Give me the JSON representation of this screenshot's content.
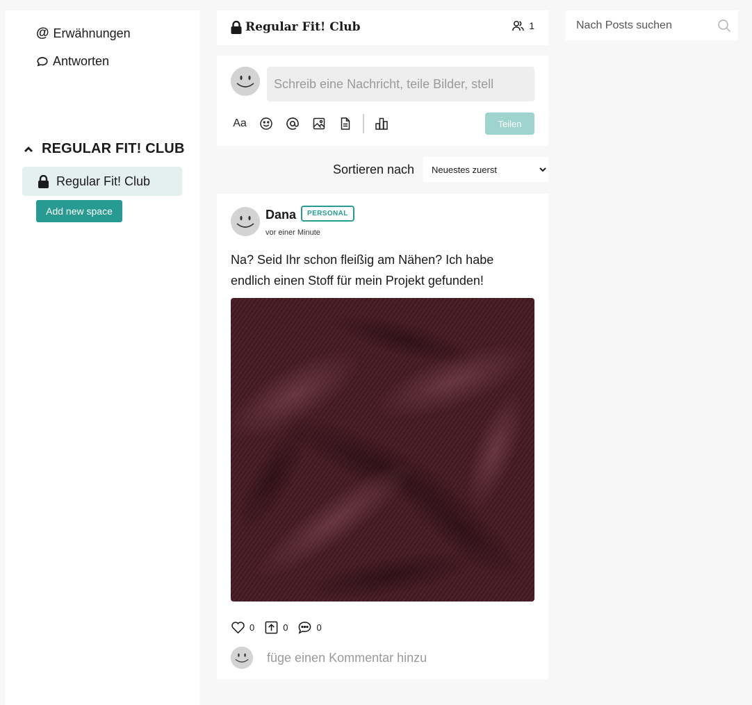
{
  "sidebar": {
    "nav": [
      {
        "label": "Erwähnungen",
        "icon": "at-icon"
      },
      {
        "label": "Antworten",
        "icon": "speech-bubble-icon"
      }
    ],
    "section_title": "REGULAR FIT! CLUB",
    "spaces": [
      {
        "label": "Regular Fit! Club",
        "icon": "lock-icon"
      }
    ],
    "add_space_label": "Add new space"
  },
  "header": {
    "title": "Regular Fit! Club",
    "members_count": "1"
  },
  "composer": {
    "placeholder": "Schreib eine Nachricht, teile Bilder, stell",
    "tools": [
      "text-format-icon",
      "emoji-icon",
      "at-icon",
      "image-icon",
      "document-icon",
      "poll-icon"
    ],
    "tool_text": "Aa",
    "share_label": "Teilen"
  },
  "sort": {
    "label": "Sortieren nach",
    "selected": "Neuestes zuerst"
  },
  "post": {
    "author": "Dana",
    "badge": "PERSONAL",
    "time": "vor einer Minute",
    "text": "Na? Seid Ihr schon fleißig am Nähen? Ich habe endlich einen Stoff für mein Projekt gefunden!",
    "likes": "0",
    "shares": "0",
    "comments": "0",
    "comment_placeholder": "füge einen Kommentar hinzu"
  },
  "search": {
    "placeholder": "Nach Posts suchen"
  },
  "colors": {
    "accent": "#279b91",
    "accent_light": "#9fd3ce",
    "selected_bg": "#e4efef",
    "fabric": "#4a1f28"
  }
}
